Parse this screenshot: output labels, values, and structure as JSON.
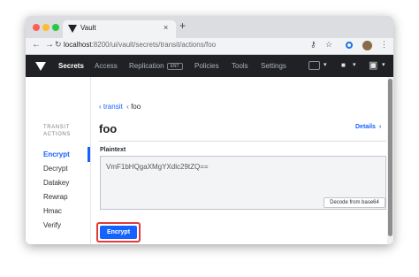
{
  "browser": {
    "tab_title": "Vault",
    "tab_close": "×",
    "new_tab": "+",
    "url_host": "localhost",
    "url_path": ":8200/ui/vault/secrets/transit/actions/foo",
    "back_icon": "←",
    "forward_icon": "→",
    "reload_icon": "C",
    "key_icon": "⚷",
    "star_icon": "☆",
    "menu_icon": "⋮"
  },
  "vault_nav": {
    "items": [
      {
        "label": "Secrets",
        "active": true
      },
      {
        "label": "Access",
        "active": false
      },
      {
        "label": "Replication",
        "active": false,
        "badge": "ENT"
      },
      {
        "label": "Policies",
        "active": false
      },
      {
        "label": "Tools",
        "active": false
      },
      {
        "label": "Settings",
        "active": false
      }
    ],
    "chevron": "▾",
    "lock_icon": "🔒",
    "user_icon": "▪"
  },
  "sidebar": {
    "heading": "TRANSIT ACTIONS",
    "items": [
      "Encrypt",
      "Decrypt",
      "Datakey",
      "Rewrap",
      "Hmac",
      "Verify"
    ],
    "active": "Encrypt"
  },
  "breadcrumb": {
    "parent": "transit",
    "current": "foo",
    "separator": "‹"
  },
  "main": {
    "title": "foo",
    "details_link": "Details",
    "details_chevron": "›",
    "field_label": "Plaintext",
    "plaintext_value": "VmF1bHQgaXMgYXdlc29tZQ==",
    "decode_button": "Decode from base64",
    "encrypt_button": "Encrypt"
  },
  "colors": {
    "accent": "#1563ff",
    "header_bg": "#1f2124",
    "highlight": "#e03a3a"
  }
}
